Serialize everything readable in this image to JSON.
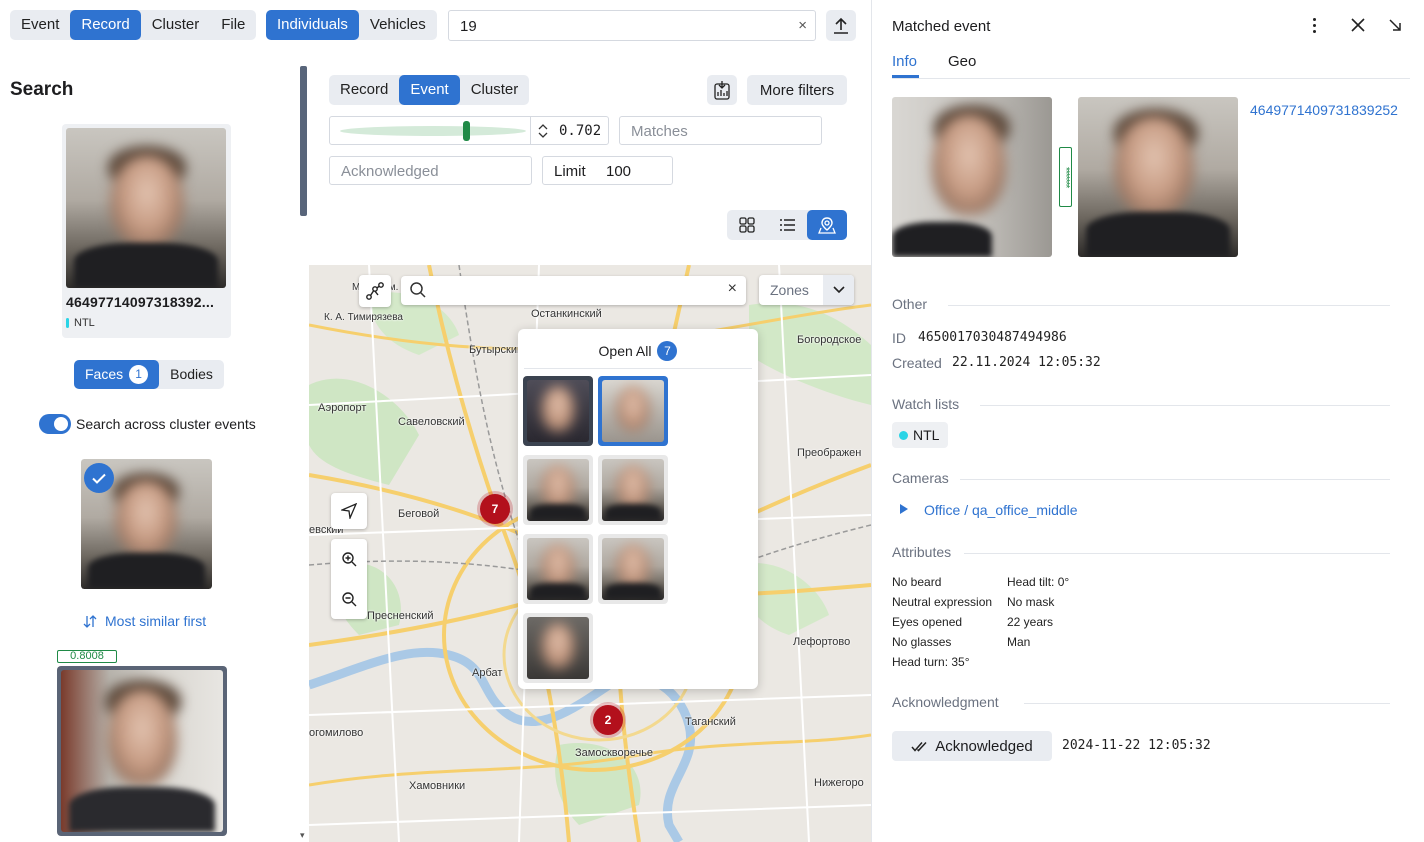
{
  "top": {
    "type_tabs": [
      "Event",
      "Record",
      "Cluster",
      "File"
    ],
    "type_active": 1,
    "object_tabs": [
      "Individuals",
      "Vehicles"
    ],
    "object_active": 0,
    "search_value": "19"
  },
  "left": {
    "heading": "Search",
    "card_id": "46497714097318392...",
    "card_watchlist": "NTL",
    "faces_label": "Faces",
    "faces_count": "1",
    "bodies_label": "Bodies",
    "cluster_toggle_label": "Search across cluster events",
    "sort_label": "Most similar first",
    "result_score": "0.8008"
  },
  "filters": {
    "tabs": [
      "Record",
      "Event",
      "Cluster"
    ],
    "active": 1,
    "more_filters": "More filters",
    "threshold_value": "0.702",
    "matches_placeholder": "Matches",
    "acknowledged_placeholder": "Acknowledged",
    "limit_label": "Limit",
    "limit_value": "100"
  },
  "map": {
    "zones_label": "Zones",
    "popup_open_all": "Open All",
    "popup_count": "7",
    "clusters": [
      {
        "count": "7"
      },
      {
        "count": "2"
      }
    ],
    "labels": [
      "Останкинский",
      "Бутырский",
      "Богородское",
      "Аэропорт",
      "Савеловский",
      "Преображен",
      "Беговой",
      "Пресненский",
      "Лефортово",
      "Арбат",
      "Таганский",
      "Замоскворечье",
      "Хамовники",
      "Нижегоро",
      "огомилово",
      "евский",
      "МСХА им.",
      "К. А. Тимирязева"
    ]
  },
  "right": {
    "title": "Matched event",
    "tabs": [
      "Info",
      "Geo"
    ],
    "active_tab": 0,
    "match_id": "4649771409731839252",
    "score_badge": "*******",
    "other_heading": "Other",
    "id_label": "ID",
    "id_value": "4650017030487494986",
    "created_label": "Created",
    "created_value": "22.11.2024 12:05:32",
    "watch_heading": "Watch lists",
    "watch_value": "NTL",
    "cameras_heading": "Cameras",
    "camera_value": "Office / qa_office_middle",
    "attributes_heading": "Attributes",
    "attributes_col1": [
      "No beard",
      "Neutral expression",
      "Eyes opened",
      "No glasses",
      "Head turn: 35°"
    ],
    "attributes_col2": [
      "Head tilt: 0°",
      "No mask",
      "22 years",
      "Man"
    ],
    "ack_heading": "Acknowledgment",
    "ack_button": "Acknowledged",
    "ack_time": "2024-11-22 12:05:32"
  },
  "colors": {
    "accent": "#2f73d0",
    "cluster": "#b3101c",
    "score": "#1f8a46",
    "watchlist_dot": "#2ad4e6"
  }
}
